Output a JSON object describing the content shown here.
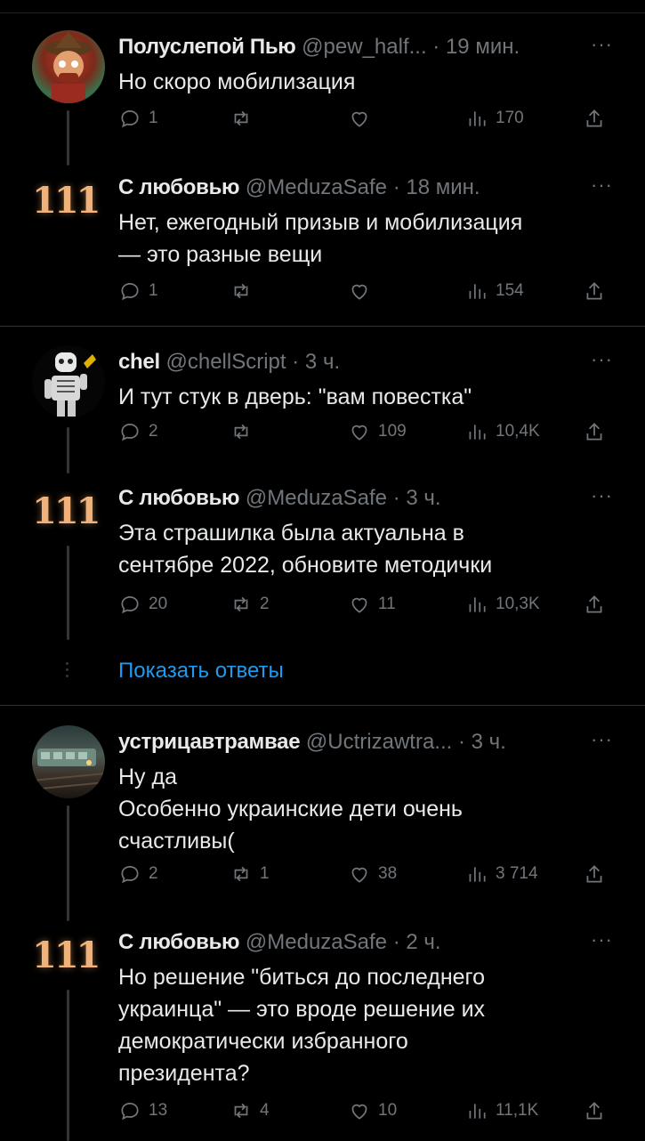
{
  "tweets": [
    {
      "name": "Полуслепой Пью",
      "handle": "@pew_half...",
      "time": "19 мин.",
      "text": "Но  скоро мобилизация",
      "replies": "1",
      "retweets": "",
      "likes": "",
      "views": "170"
    },
    {
      "name": "С любовью",
      "handle": "@MeduzaSafe",
      "time": "18 мин.",
      "text": "Нет, ежегодный призыв и мобилизация\n— это разные вещи",
      "replies": "1",
      "retweets": "",
      "likes": "",
      "views": "154"
    },
    {
      "name": "chel",
      "handle": "@chellScript",
      "time": "3 ч.",
      "text": "И тут стук в дверь: \"вам повестка\"",
      "replies": "2",
      "retweets": "",
      "likes": "109",
      "views": "10,4K"
    },
    {
      "name": "С любовью",
      "handle": "@MeduzaSafe",
      "time": "3 ч.",
      "text": "Эта страшилка была актуальна в\nсентябре 2022, обновите методички",
      "replies": "20",
      "retweets": "2",
      "likes": "11",
      "views": "10,3K"
    },
    {
      "name": "устрицавтрамвае",
      "handle": "@Uctrizawtra...",
      "time": "3 ч.",
      "text": "Ну да\nОсобенно украинские дети очень\nсчастливы(",
      "replies": "2",
      "retweets": "1",
      "likes": "38",
      "views": "3 714"
    },
    {
      "name": "С любовью",
      "handle": "@MeduzaSafe",
      "time": "2 ч.",
      "text": "Но решение \"биться до последнего\nукраинца\" — это вроде решение их\nдемократически избранного\nпрезидента?",
      "replies": "13",
      "retweets": "4",
      "likes": "10",
      "views": "11,1K"
    }
  ],
  "show_replies": "Показать ответы",
  "meduza_logo": "111",
  "more_glyph": "···",
  "dot": "·",
  "colors": {
    "accent": "#1d9bf0",
    "muted": "#71767b",
    "text": "#e7e9ea",
    "background": "#000000"
  }
}
